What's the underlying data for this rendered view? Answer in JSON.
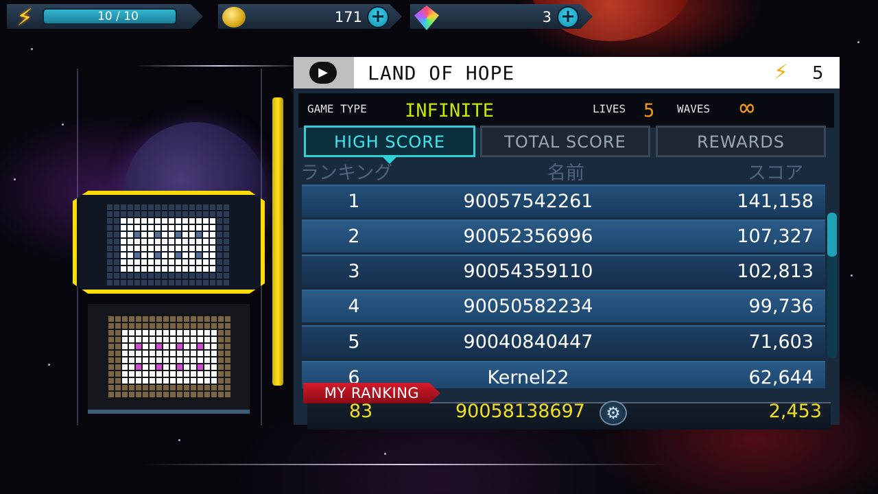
{
  "colors": {
    "accent_cyan": "#2fd0d7",
    "selected_yellow": "#ffdd00",
    "score_yellow": "#f2e020",
    "infinite_green": "#c9e600",
    "lives_orange": "#f29a16",
    "ranking_red": "#d41a2a"
  },
  "resources": {
    "energy": {
      "icon": "lightning-icon",
      "text": "10 / 10",
      "fill": 1.0
    },
    "coins": {
      "icon": "coin-stack-icon",
      "value": "171",
      "plus_icon": "plus-icon"
    },
    "gems": {
      "icon": "prism-gem-icon",
      "value": "3",
      "plus_icon": "plus-icon"
    }
  },
  "level": {
    "title": "LAND OF HOPE",
    "play_icon": "play-icon",
    "cost_icon": "lightning-icon",
    "cost": "5"
  },
  "info": {
    "game_type_label": "GAME TYPE",
    "game_type_value": "INFINITE",
    "lives_label": "LIVES",
    "lives_value": "5",
    "waves_label": "WAVES",
    "waves_value": "∞"
  },
  "tabs": [
    {
      "label": "HIGH SCORE",
      "active": true
    },
    {
      "label": "TOTAL SCORE",
      "active": false
    },
    {
      "label": "REWARDS",
      "active": false
    }
  ],
  "table": {
    "headers": [
      "ランキング",
      "名前",
      "スコア"
    ],
    "rows": [
      {
        "rank": "1",
        "name": "90057542261",
        "score": "141,158"
      },
      {
        "rank": "2",
        "name": "90052356996",
        "score": "107,327"
      },
      {
        "rank": "3",
        "name": "90054359110",
        "score": "102,813"
      },
      {
        "rank": "4",
        "name": "90050582234",
        "score": "99,736"
      },
      {
        "rank": "5",
        "name": "90040840447",
        "score": "71,603"
      },
      {
        "rank": "6",
        "name": "Kernel22",
        "score": "62,644"
      }
    ]
  },
  "my_ranking": {
    "label": "MY RANKING",
    "rank": "83",
    "name": "90058138697",
    "score": "2,453",
    "settings_icon": "gear-icon"
  }
}
